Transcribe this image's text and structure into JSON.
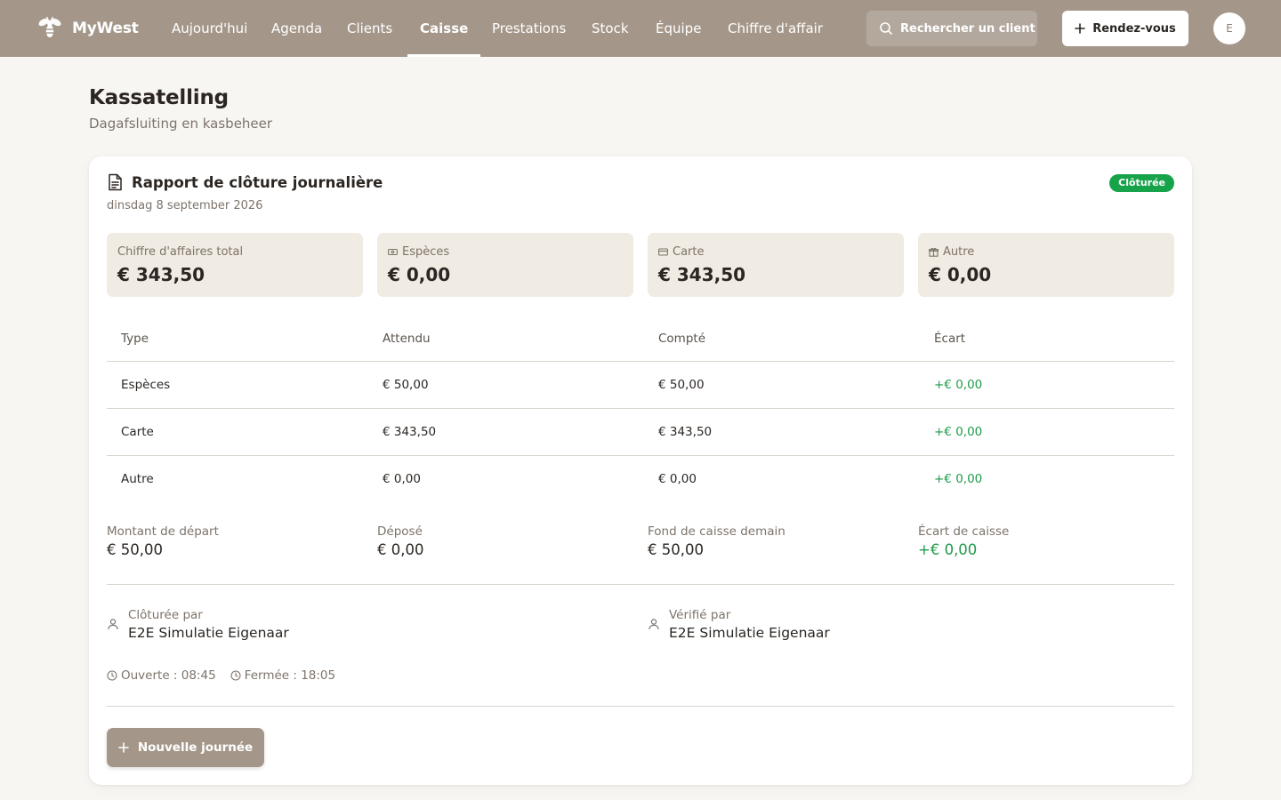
{
  "app": {
    "name": "MyWest"
  },
  "nav": [
    {
      "label": "Aujourd'hui"
    },
    {
      "label": "Agenda"
    },
    {
      "label": "Clients"
    },
    {
      "label": "Caisse",
      "active": true
    },
    {
      "label": "Prestations"
    },
    {
      "label": "Stock"
    },
    {
      "label": "Équipe"
    },
    {
      "label": "Chiffre d'affair"
    }
  ],
  "header": {
    "search_label": "Rechercher un client",
    "appointment_button": "Rendez-vous",
    "avatar_initial": "E"
  },
  "page": {
    "title": "Kassatelling",
    "subtitle": "Dagafsluiting en kasbeheer"
  },
  "report": {
    "title": "Rapport de clôture journalière",
    "date": "dinsdag 8 september 2026",
    "status": "Clôturée",
    "stats": [
      {
        "label": "Chiffre d'affaires total",
        "value": "€ 343,50",
        "icon": ""
      },
      {
        "label": "Espèces",
        "value": "€ 0,00",
        "icon": "cash-icon"
      },
      {
        "label": "Carte",
        "value": "€ 343,50",
        "icon": "card-icon"
      },
      {
        "label": "Autre",
        "value": "€ 0,00",
        "icon": "gift-icon"
      }
    ],
    "table": {
      "headers": [
        "Type",
        "Attendu",
        "Compté",
        "Écart"
      ],
      "rows": [
        [
          "Espèces",
          "€ 50,00",
          "€ 50,00",
          "+€ 0,00"
        ],
        [
          "Carte",
          "€ 343,50",
          "€ 343,50",
          "+€ 0,00"
        ],
        [
          "Autre",
          "€ 0,00",
          "€ 0,00",
          "+€ 0,00"
        ]
      ]
    },
    "summary": [
      {
        "label": "Montant de départ",
        "value": "€ 50,00"
      },
      {
        "label": "Déposé",
        "value": "€ 0,00"
      },
      {
        "label": "Fond de caisse demain",
        "value": "€ 50,00"
      },
      {
        "label": "Écart de caisse",
        "value": "+€ 0,00"
      }
    ],
    "closed_by": {
      "label": "Clôturée par",
      "name": "E2E Simulatie Eigenaar"
    },
    "verified_by": {
      "label": "Vérifié par",
      "name": "E2E Simulatie Eigenaar"
    },
    "opened": "Ouverte : 08:45",
    "closed": "Fermée : 18:05",
    "new_day_button": "Nouvelle journée"
  },
  "colors": {
    "topbar": "#a4978a",
    "accent_positive": "#1f9a4a",
    "badge": "#16a34a",
    "stat_background": "#f0ebe3"
  }
}
